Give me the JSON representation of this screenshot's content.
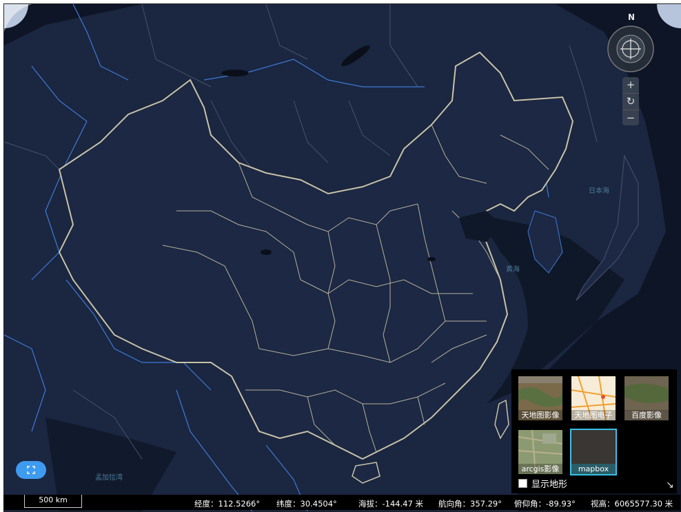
{
  "compass": {
    "north": "N"
  },
  "zoom": {
    "in": "+",
    "reset": "↻",
    "out": "−"
  },
  "basemaps": [
    {
      "label": "天地图影像",
      "active": false
    },
    {
      "label": "天地图电子",
      "active": false
    },
    {
      "label": "百度影像",
      "active": false
    },
    {
      "label": "arcgis影像",
      "active": false
    },
    {
      "label": "mapbox",
      "active": true
    }
  ],
  "terrain": {
    "label": "显示地形",
    "checked": false
  },
  "map_labels": {
    "japan_sea": "日本海",
    "yellow_sea": "黄海",
    "bay_of_bengal": "孟加拉湾"
  },
  "status": {
    "scale": "500 km",
    "lng": "经度：112.5266°",
    "lat": "纬度：30.4504°",
    "alt": "海拔：-144.47 米",
    "heading": "航向角：357.29°",
    "pitch": "俯仰角：-89.93°",
    "height": "视高：6065577.30 米"
  },
  "colors": {
    "accent": "#39c1ea",
    "button": "#3f9bf0",
    "land": "#1b2640",
    "border_china": "#c8c3a8",
    "border_foreign": "#3e7bd9"
  }
}
